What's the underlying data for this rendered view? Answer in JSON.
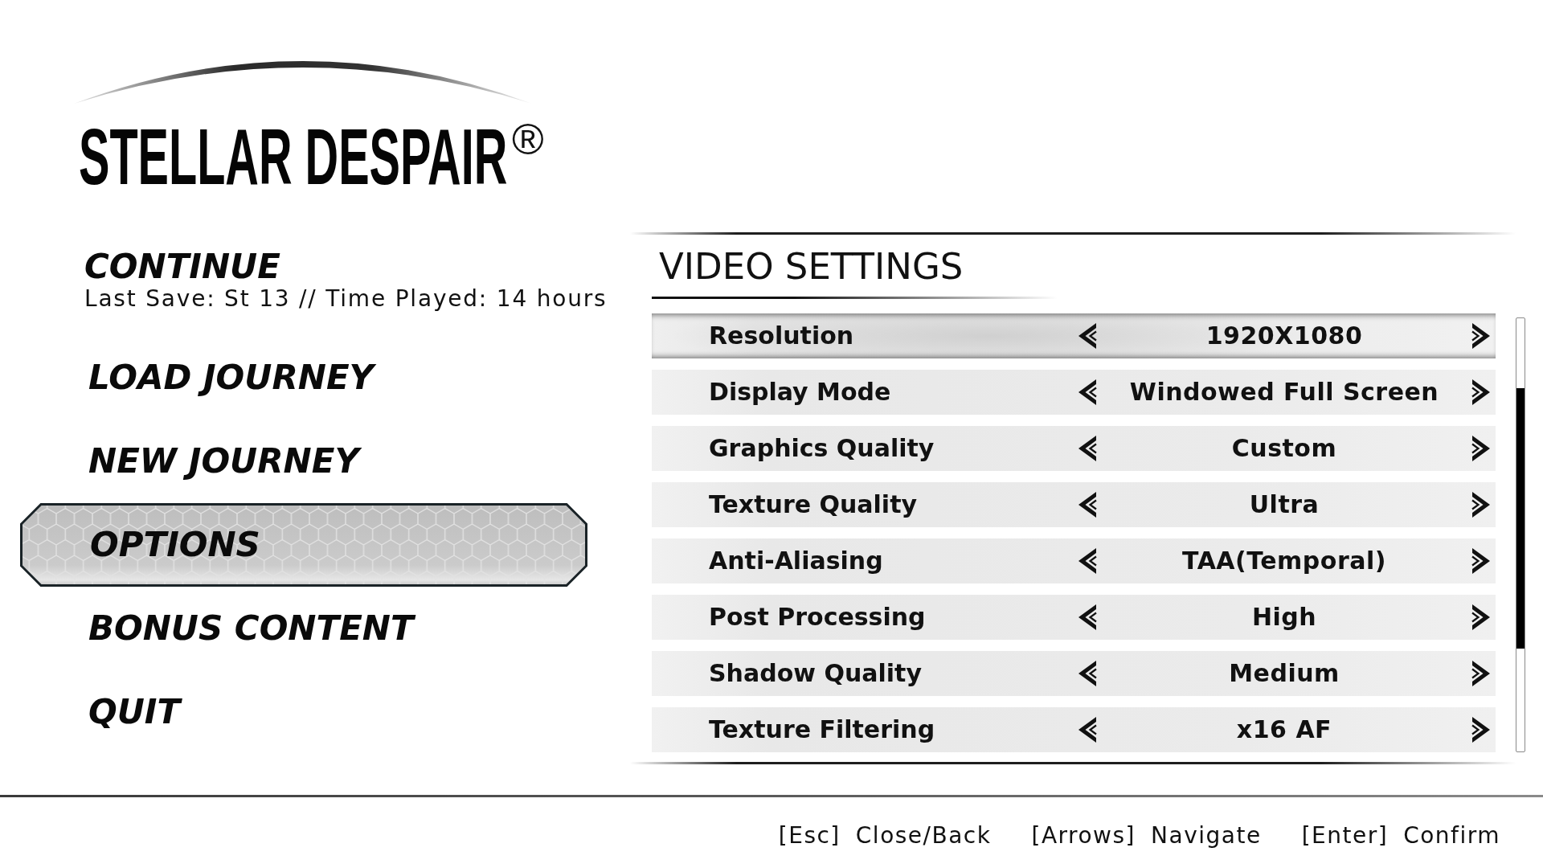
{
  "game_logo": {
    "title": "STELLAR DESPAIR",
    "registered_mark": "®"
  },
  "main_menu": {
    "items": [
      {
        "label": "CONTINUE",
        "subtitle": "Last Save: St 13 // Time Played: 14 hours",
        "selected": false
      },
      {
        "label": "LOAD JOURNEY",
        "selected": false
      },
      {
        "label": "NEW JOURNEY",
        "selected": false
      },
      {
        "label": "OPTIONS",
        "selected": true
      },
      {
        "label": "BONUS CONTENT",
        "selected": false
      },
      {
        "label": "QUIT",
        "selected": false
      }
    ]
  },
  "video_settings": {
    "title": "VIDEO SETTINGS",
    "rows": [
      {
        "label": "Resolution",
        "value": "1920X1080",
        "selected": true
      },
      {
        "label": "Display Mode",
        "value": "Windowed Full Screen",
        "selected": false
      },
      {
        "label": "Graphics Quality",
        "value": "Custom",
        "selected": false
      },
      {
        "label": "Texture Quality",
        "value": "Ultra",
        "selected": false
      },
      {
        "label": "Anti-Aliasing",
        "value": "TAA(Temporal)",
        "selected": false
      },
      {
        "label": "Post Processing",
        "value": "High",
        "selected": false
      },
      {
        "label": "Shadow Quality",
        "value": "Medium",
        "selected": false
      },
      {
        "label": "Texture Filtering",
        "value": "x16 AF",
        "selected": false
      }
    ]
  },
  "footer": {
    "hints": [
      {
        "key": "[Esc]",
        "action": "Close/Back"
      },
      {
        "key": "[Arrows]",
        "action": "Navigate"
      },
      {
        "key": "[Enter]",
        "action": "Confirm"
      }
    ]
  }
}
